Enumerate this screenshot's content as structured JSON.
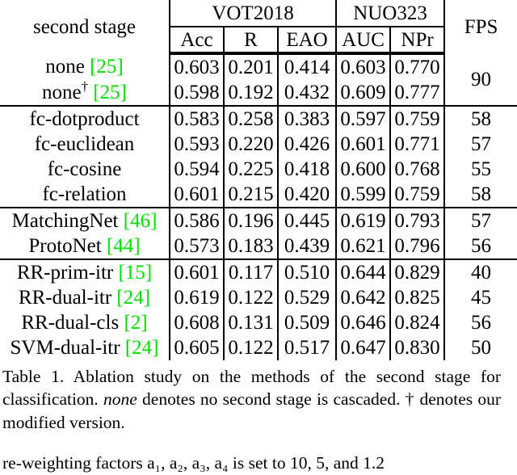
{
  "table": {
    "header": {
      "method_col": "second stage",
      "groups": [
        {
          "label": "VOT2018",
          "span": 3
        },
        {
          "label": "NUO323",
          "span": 2
        }
      ],
      "fps_label": "FPS",
      "subheaders": [
        "Acc",
        "R",
        "EAO",
        "AUC",
        "NPr"
      ]
    },
    "groups": [
      {
        "rows": [
          {
            "method": "none",
            "dagger": "",
            "cite": "[25]",
            "acc": "0.603",
            "r": "0.201",
            "eao": "0.414",
            "auc": "0.603",
            "npr": "0.770",
            "fps": "90",
            "fps_rowspan": 2,
            "fps_bold": true,
            "bold": []
          },
          {
            "method": "none",
            "dagger": "†",
            "cite": "[25]",
            "acc": "0.598",
            "r": "0.192",
            "eao": "0.432",
            "auc": "0.609",
            "npr": "0.777",
            "fps": "",
            "fps_rowspan": 0,
            "fps_bold": false,
            "bold": []
          }
        ]
      },
      {
        "rows": [
          {
            "method": "fc-dotproduct",
            "dagger": "",
            "cite": "",
            "acc": "0.583",
            "r": "0.258",
            "eao": "0.383",
            "auc": "0.597",
            "npr": "0.759",
            "fps": "58",
            "fps_rowspan": 1,
            "fps_bold": false,
            "bold": []
          },
          {
            "method": "fc-euclidean",
            "dagger": "",
            "cite": "",
            "acc": "0.593",
            "r": "0.220",
            "eao": "0.426",
            "auc": "0.601",
            "npr": "0.771",
            "fps": "57",
            "fps_rowspan": 1,
            "fps_bold": false,
            "bold": []
          },
          {
            "method": "fc-cosine",
            "dagger": "",
            "cite": "",
            "acc": "0.594",
            "r": "0.225",
            "eao": "0.418",
            "auc": "0.600",
            "npr": "0.768",
            "fps": "55",
            "fps_rowspan": 1,
            "fps_bold": false,
            "bold": []
          },
          {
            "method": "fc-relation",
            "dagger": "",
            "cite": "",
            "acc": "0.601",
            "r": "0.215",
            "eao": "0.420",
            "auc": "0.599",
            "npr": "0.759",
            "fps": "58",
            "fps_rowspan": 1,
            "fps_bold": false,
            "bold": []
          }
        ]
      },
      {
        "rows": [
          {
            "method": "MatchingNet",
            "dagger": "",
            "cite": "[46]",
            "acc": "0.586",
            "r": "0.196",
            "eao": "0.445",
            "auc": "0.619",
            "npr": "0.793",
            "fps": "57",
            "fps_rowspan": 1,
            "fps_bold": false,
            "bold": []
          },
          {
            "method": "ProtoNet",
            "dagger": "",
            "cite": "[44]",
            "acc": "0.573",
            "r": "0.183",
            "eao": "0.439",
            "auc": "0.621",
            "npr": "0.796",
            "fps": "56",
            "fps_rowspan": 1,
            "fps_bold": false,
            "bold": []
          }
        ]
      },
      {
        "rows": [
          {
            "method": "RR-prim-itr",
            "dagger": "",
            "cite": "[15]",
            "acc": "0.601",
            "r": "0.117",
            "eao": "0.510",
            "auc": "0.644",
            "npr": "0.829",
            "fps": "40",
            "fps_rowspan": 1,
            "fps_bold": false,
            "bold": []
          },
          {
            "method": "RR-dual-itr",
            "dagger": "",
            "cite": "[24]",
            "acc": "0.619",
            "r": "0.122",
            "eao": "0.529",
            "auc": "0.642",
            "npr": "0.825",
            "fps": "45",
            "fps_rowspan": 1,
            "fps_bold": false,
            "bold": [
              "acc",
              "r",
              "eao"
            ]
          },
          {
            "method": "RR-dual-cls",
            "dagger": "",
            "cite": "[2]",
            "acc": "0.608",
            "r": "0.131",
            "eao": "0.509",
            "auc": "0.646",
            "npr": "0.824",
            "fps": "56",
            "fps_rowspan": 1,
            "fps_bold": false,
            "bold": []
          },
          {
            "method": "SVM-dual-itr",
            "dagger": "",
            "cite": "[24]",
            "acc": "0.605",
            "r": "0.122",
            "eao": "0.517",
            "auc": "0.647",
            "npr": "0.830",
            "fps": "50",
            "fps_rowspan": 1,
            "fps_bold": false,
            "bold": [
              "auc",
              "npr"
            ]
          }
        ]
      }
    ]
  },
  "caption": {
    "prefix": "Table 1. Ablation study on the methods of the second stage for classification. ",
    "italic_word": "none",
    "middle": " denotes no second stage is cascaded. † denotes our modified version."
  },
  "trailing_paragraph": {
    "text": "re-weighting factors a₁, a₂, a₃, a₄ is set to 10, 5, and 1.2"
  },
  "colors": {
    "citation_green": "#00e000",
    "text_black": "#000000",
    "background": "#ffffff"
  }
}
